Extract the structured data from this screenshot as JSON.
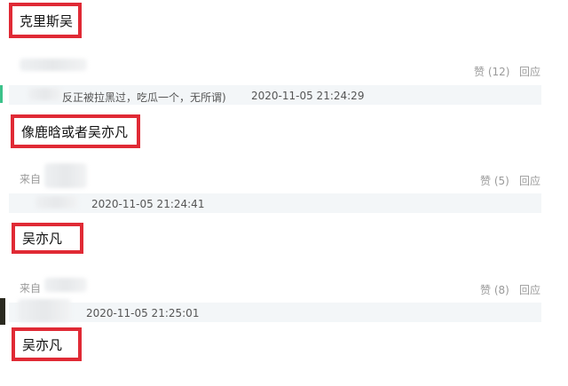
{
  "comments": [
    {
      "highlight": "克里斯吴",
      "like_label": "赞 (12)",
      "reply_label": "回应",
      "quote_text": "反正被拉黑过，吃瓜一个，无所谓)",
      "timestamp": "2020-11-05 21:24:29"
    },
    {
      "highlight": "像鹿晗或者吴亦凡",
      "source_label": "来自",
      "like_label": "赞 (5)",
      "reply_label": "回应",
      "timestamp": "2020-11-05 21:24:41"
    },
    {
      "highlight": "吴亦凡",
      "source_label": "来自",
      "like_label": "赞 (8)",
      "reply_label": "回应",
      "timestamp": "2020-11-05 21:25:01"
    },
    {
      "highlight": "吴亦凡"
    }
  ],
  "colors": {
    "highlight_border": "#e02a35",
    "quote_background": "#f3f6f8",
    "meta_text": "#9a9a9a"
  }
}
